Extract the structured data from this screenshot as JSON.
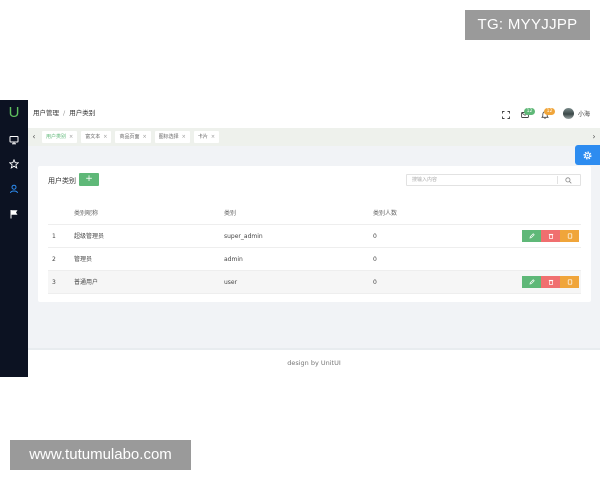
{
  "watermarks": {
    "top": "TG: MYYJJPP",
    "bottom": "www.tutumulabo.com"
  },
  "colors": {
    "sidebar": "#0c1222",
    "accent_green": "#5fb878",
    "danger": "#f06f6f",
    "warning": "#f0a53a",
    "primary": "#2d8cf0"
  },
  "sidebar": {
    "logo": "U",
    "items": [
      {
        "icon": "monitor-icon"
      },
      {
        "icon": "star-icon"
      },
      {
        "icon": "user-icon",
        "active": true
      },
      {
        "icon": "flag-icon"
      }
    ]
  },
  "header": {
    "breadcrumb": [
      "用户管理",
      "用户类别"
    ],
    "separator": "/",
    "icons": [
      "fullscreen-icon",
      "message-icon",
      "notification-icon"
    ],
    "message_count": "12",
    "notification_count": "12",
    "username": "小海"
  },
  "tabs": [
    {
      "label": "用户类别",
      "active": true
    },
    {
      "label": "富文本"
    },
    {
      "label": "商品页面"
    },
    {
      "label": "图标选择"
    },
    {
      "label": "卡片"
    }
  ],
  "tab_close": "×",
  "card": {
    "title": "用户类别",
    "add_label": "+",
    "search_placeholder": "搜输入内容"
  },
  "table": {
    "columns": [
      "",
      "类别昵称",
      "类别",
      "类别人数"
    ],
    "rows": [
      {
        "id": "1",
        "name": "超级管理员",
        "type": "super_admin",
        "count": "0"
      },
      {
        "id": "2",
        "name": "管理员",
        "type": "admin",
        "count": "0"
      },
      {
        "id": "3",
        "name": "普通用户",
        "type": "user",
        "count": "0"
      }
    ]
  },
  "footer": {
    "text": "design by UnitUI"
  }
}
